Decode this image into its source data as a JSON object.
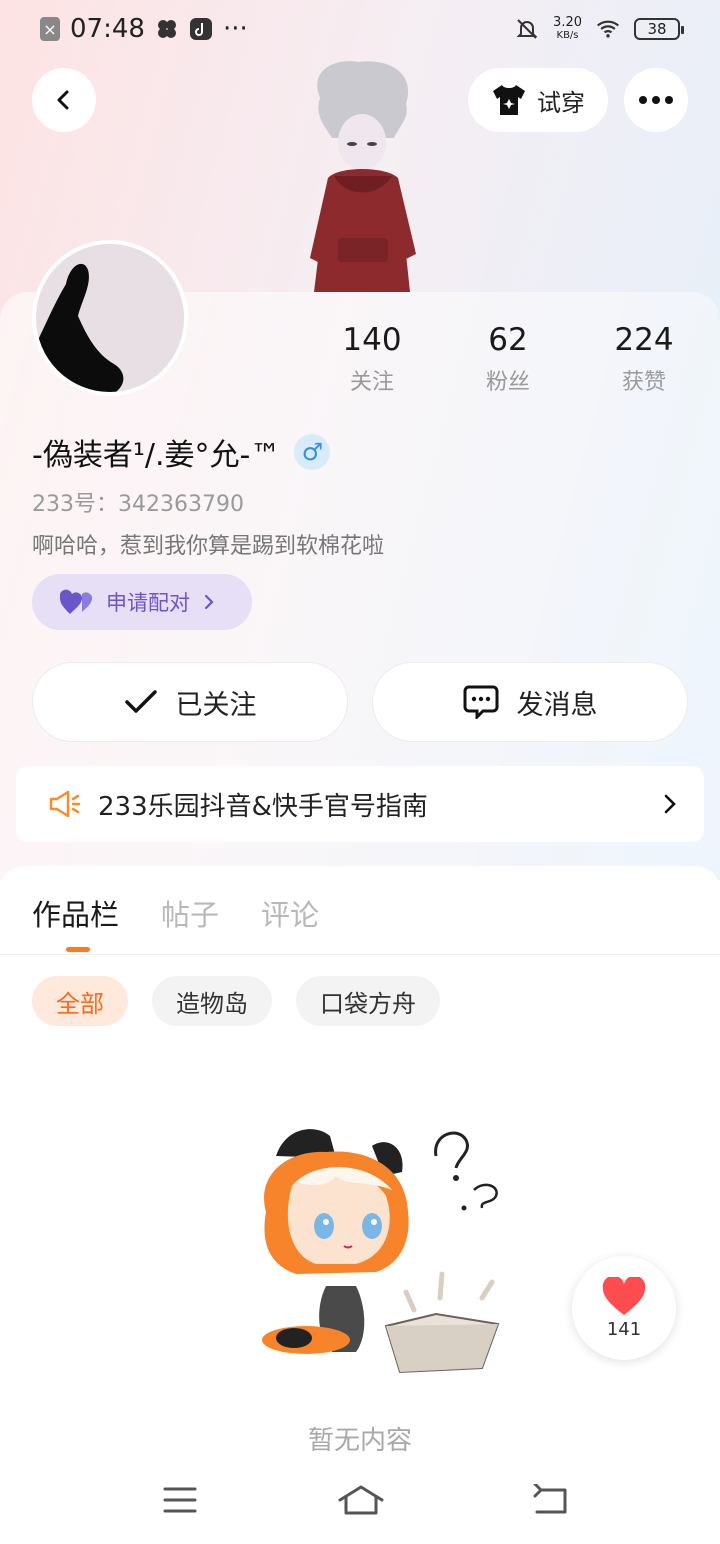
{
  "status_bar": {
    "time": "07:48",
    "net_speed_value": "3.20",
    "net_speed_unit": "KB/s",
    "battery": "38"
  },
  "header": {
    "tryon_label": "试穿"
  },
  "profile": {
    "stats": [
      {
        "value": "140",
        "label": "关注"
      },
      {
        "value": "62",
        "label": "粉丝"
      },
      {
        "value": "224",
        "label": "获赞"
      }
    ],
    "name": "-偽装者¹/.姜°允-™",
    "gender_symbol": "♂",
    "uid_text": "233号：342363790",
    "bio": "啊哈哈，惹到我你算是踢到软棉花啦",
    "pair_label": "申请配对"
  },
  "actions": {
    "followed_label": "已关注",
    "message_label": "发消息"
  },
  "notice": {
    "text": "233乐园抖音&快手官号指南"
  },
  "tabs": [
    {
      "label": "作品栏",
      "active": true
    },
    {
      "label": "帖子",
      "active": false
    },
    {
      "label": "评论",
      "active": false
    }
  ],
  "filters": [
    {
      "label": "全部",
      "active": true
    },
    {
      "label": "造物岛",
      "active": false
    },
    {
      "label": "口袋方舟",
      "active": false
    }
  ],
  "empty_state": {
    "text": "暂无内容"
  },
  "like_fab": {
    "count": "141"
  },
  "colors": {
    "accent": "#ff7a1a",
    "pair_purple": "#6a55c9",
    "gender_blue": "#3a8ee0",
    "like_red": "#ff4d4f"
  }
}
